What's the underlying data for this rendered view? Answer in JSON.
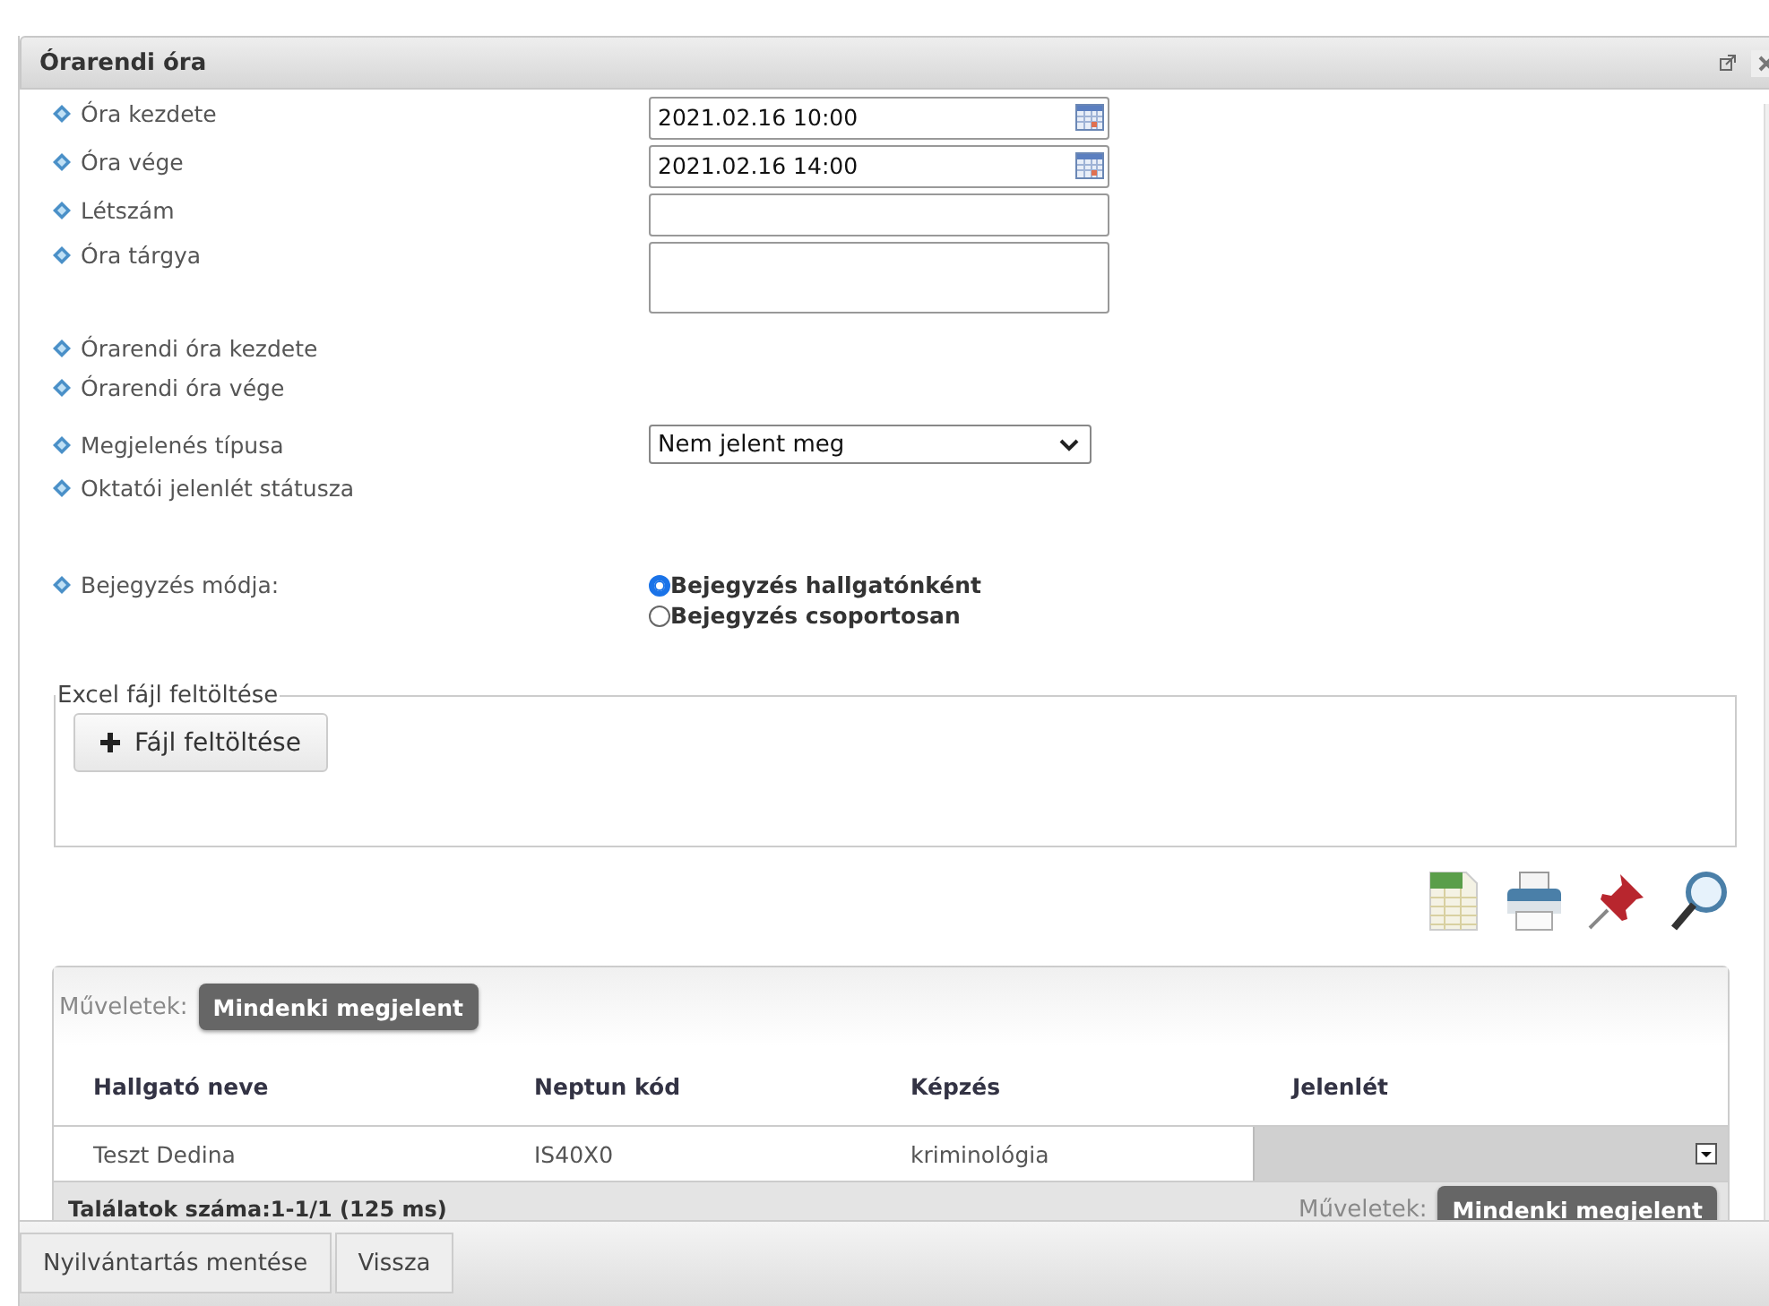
{
  "window": {
    "title": "Órarendi óra"
  },
  "fields": [
    {
      "label": "Óra kezdete",
      "kind": "date",
      "value": "2021.02.16 10:00"
    },
    {
      "label": "Óra vége",
      "kind": "date",
      "value": "2021.02.16 14:00"
    },
    {
      "label": "Létszám",
      "kind": "text"
    },
    {
      "label": "Óra tárgya",
      "kind": "textarea"
    },
    {
      "label": "Órarendi óra kezdete",
      "kind": "none"
    },
    {
      "label": "Órarendi óra vége",
      "kind": "none"
    },
    {
      "label": "Megjelenés típusa",
      "kind": "select",
      "value": "Nem jelent meg"
    },
    {
      "label": "Oktatói jelenlét státusza",
      "kind": "none"
    }
  ],
  "entry_mode": {
    "label": "Bejegyzés módja:",
    "options": [
      {
        "label": "Bejegyzés hallgatónként",
        "selected": true
      },
      {
        "label": "Bejegyzés csoportosan",
        "selected": false
      }
    ]
  },
  "upload": {
    "legend": "Excel fájl feltöltése",
    "button": "Fájl feltöltése"
  },
  "grid": {
    "actions_label": "Műveletek:",
    "action_button": "Mindenki megjelent",
    "columns": [
      "Hallgató neve",
      "Neptun kód",
      "Képzés",
      "Jelenlét"
    ],
    "rows": [
      {
        "cells": [
          "Teszt Dedina",
          "IS40X0",
          "kriminológia"
        ]
      }
    ],
    "footer": {
      "results": "Találatok száma:1-1/1 (125 ms)",
      "actions_label": "Műveletek:",
      "action_button": "Mindenki megjelent"
    }
  },
  "buttons": [
    "Nyilvántartás mentése",
    "Vissza"
  ]
}
